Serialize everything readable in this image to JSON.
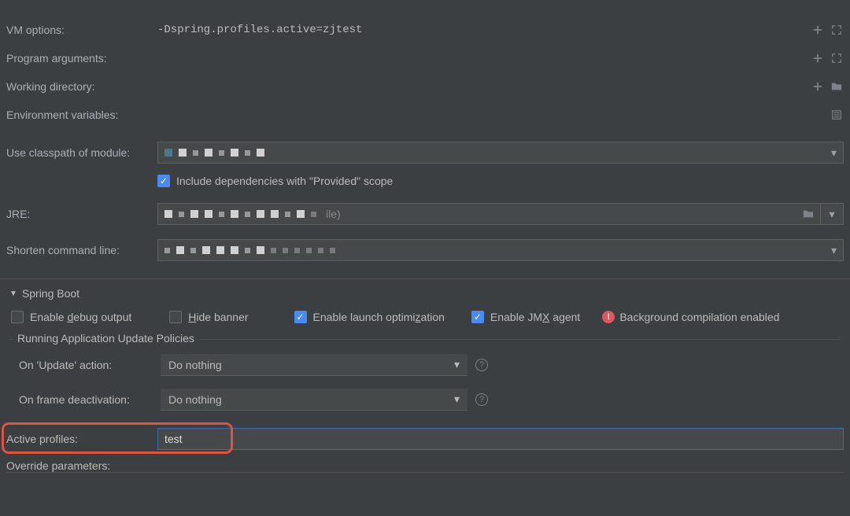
{
  "fields": {
    "vm_options": {
      "label": "VM options:",
      "value": "-Dspring.profiles.active=zjtest"
    },
    "program_arguments": {
      "label": "Program arguments:",
      "value": ""
    },
    "working_directory": {
      "label": "Working directory:",
      "value": ""
    },
    "environment_variables": {
      "label": "Environment variables:",
      "value": ""
    },
    "classpath_module": {
      "label": "Use classpath of module:",
      "value": ""
    },
    "include_provided": {
      "label": "Include dependencies with \"Provided\" scope",
      "checked": true
    },
    "jre": {
      "label": "JRE:",
      "value": ""
    },
    "shorten_cmd": {
      "label": "Shorten command line:",
      "value": ""
    }
  },
  "spring_boot": {
    "section_title": "Spring Boot",
    "options": {
      "enable_debug": {
        "label_pre": "Enable ",
        "label_u": "d",
        "label_post": "ebug output",
        "checked": false
      },
      "hide_banner": {
        "label_pre": "",
        "label_u": "H",
        "label_post": "ide banner",
        "checked": false
      },
      "enable_launch_opt": {
        "label_pre": "Enable launch optimi",
        "label_u": "z",
        "label_post": "ation",
        "checked": true
      },
      "enable_jmx": {
        "label_pre": "Enable JM",
        "label_u": "X",
        "label_post": " agent",
        "checked": true
      },
      "bg_compile": {
        "label": "Background compilation enabled",
        "warn": true
      }
    },
    "update_policies": {
      "title": "Running Application Update Policies",
      "on_update": {
        "label": "On 'Update' action:",
        "value": "Do nothing"
      },
      "on_frame": {
        "label": "On frame deactivation:",
        "value": "Do nothing"
      }
    },
    "active_profiles": {
      "label": "Active profiles:",
      "value": "test"
    },
    "override_params": {
      "label": "Override parameters:"
    }
  }
}
